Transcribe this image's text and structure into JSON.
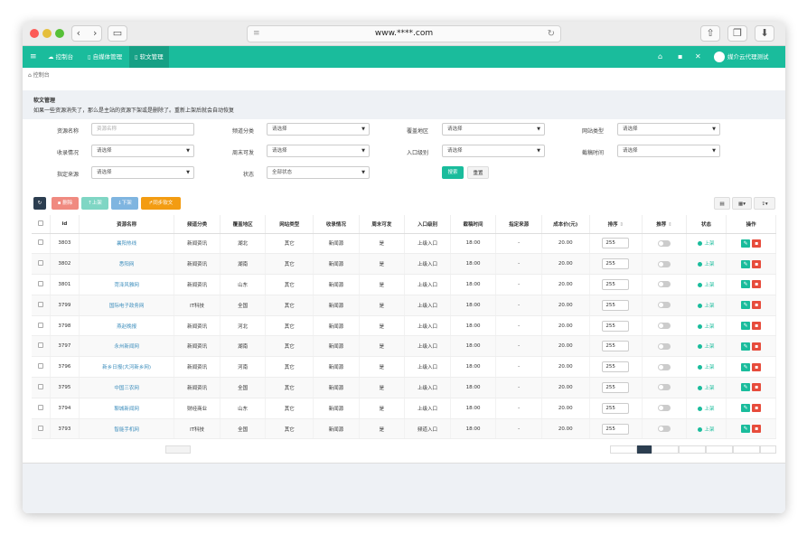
{
  "browser": {
    "url": "www.****.com"
  },
  "nav": {
    "items": [
      {
        "label": "控制台"
      },
      {
        "label": "自媒体管理"
      },
      {
        "label": "软文管理"
      }
    ],
    "user": "媒介云代理测试"
  },
  "breadcrumb": "控制台",
  "notice": {
    "title": "软文管理",
    "text": "如果一些资源消失了，那么是主站的资源下架或是删除了。重新上架后就会自动恢复"
  },
  "filters": {
    "resource_name": {
      "label": "资源名称",
      "placeholder": "资源名称"
    },
    "channel": {
      "label": "频道分类",
      "value": "请选择"
    },
    "region": {
      "label": "覆盖地区",
      "value": "请选择"
    },
    "site_type": {
      "label": "网站类型",
      "value": "请选择"
    },
    "index": {
      "label": "收录情况",
      "value": "请选择"
    },
    "weekend": {
      "label": "周末可发",
      "value": "请选择"
    },
    "entry": {
      "label": "入口级别",
      "value": "请选择"
    },
    "deadline": {
      "label": "截稿时间",
      "value": "请选择"
    },
    "source": {
      "label": "指定来源",
      "value": "请选择"
    },
    "status": {
      "label": "状态",
      "value": "全部状态"
    },
    "search_label": "搜索",
    "reset_label": "重置"
  },
  "toolbar": {
    "delete_label": "删除",
    "up_label": "上架",
    "down_label": "下架",
    "sync_label": "同步软文"
  },
  "table": {
    "headers": [
      "id",
      "资源名称",
      "频道分类",
      "覆盖地区",
      "网站类型",
      "收录情况",
      "周末可发",
      "入口级别",
      "截稿时间",
      "指定来源",
      "成本价(元)",
      "排序",
      "推荐",
      "状态",
      "操作"
    ],
    "rows": [
      {
        "id": "3803",
        "name": "襄阳热线",
        "channel": "新闻资讯",
        "region": "湖北",
        "type": "其它",
        "index": "新闻源",
        "weekend": "是",
        "entry": "上级入口",
        "deadline": "18:00",
        "source": "-",
        "price": "20.00",
        "sort": "255",
        "status": "上架"
      },
      {
        "id": "3802",
        "name": "悉阳网",
        "channel": "新闻资讯",
        "region": "湖南",
        "type": "其它",
        "index": "新闻源",
        "weekend": "是",
        "entry": "上级入口",
        "deadline": "18:00",
        "source": "-",
        "price": "20.00",
        "sort": "255",
        "status": "上架"
      },
      {
        "id": "3801",
        "name": "菏泽风雅网",
        "channel": "新闻资讯",
        "region": "山东",
        "type": "其它",
        "index": "新闻源",
        "weekend": "是",
        "entry": "上级入口",
        "deadline": "18:00",
        "source": "-",
        "price": "20.00",
        "sort": "255",
        "status": "上架"
      },
      {
        "id": "3799",
        "name": "国际电子政务网",
        "channel": "IT科技",
        "region": "全国",
        "type": "其它",
        "index": "新闻源",
        "weekend": "是",
        "entry": "上级入口",
        "deadline": "18:00",
        "source": "-",
        "price": "20.00",
        "sort": "255",
        "status": "上架"
      },
      {
        "id": "3798",
        "name": "燕赵晚报",
        "channel": "新闻资讯",
        "region": "河北",
        "type": "其它",
        "index": "新闻源",
        "weekend": "是",
        "entry": "上级入口",
        "deadline": "18:00",
        "source": "-",
        "price": "20.00",
        "sort": "255",
        "status": "上架"
      },
      {
        "id": "3797",
        "name": "永州新闻网",
        "channel": "新闻资讯",
        "region": "湖南",
        "type": "其它",
        "index": "新闻源",
        "weekend": "是",
        "entry": "上级入口",
        "deadline": "18:00",
        "source": "-",
        "price": "20.00",
        "sort": "255",
        "status": "上架"
      },
      {
        "id": "3796",
        "name": "新乡日报(大河新乡网)",
        "channel": "新闻资讯",
        "region": "河南",
        "type": "其它",
        "index": "新闻源",
        "weekend": "是",
        "entry": "上级入口",
        "deadline": "18:00",
        "source": "-",
        "price": "20.00",
        "sort": "255",
        "status": "上架"
      },
      {
        "id": "3795",
        "name": "中国三农网",
        "channel": "新闻资讯",
        "region": "全国",
        "type": "其它",
        "index": "新闻源",
        "weekend": "是",
        "entry": "上级入口",
        "deadline": "18:00",
        "source": "-",
        "price": "20.00",
        "sort": "255",
        "status": "上架"
      },
      {
        "id": "3794",
        "name": "聊城新闻网",
        "channel": "财经商业",
        "region": "山东",
        "type": "其它",
        "index": "新闻源",
        "weekend": "是",
        "entry": "上级入口",
        "deadline": "18:00",
        "source": "-",
        "price": "20.00",
        "sort": "255",
        "status": "上架"
      },
      {
        "id": "3793",
        "name": "智能手机网",
        "channel": "IT科技",
        "region": "全国",
        "type": "其它",
        "index": "新闻源",
        "weekend": "是",
        "entry": "频道入口",
        "deadline": "18:00",
        "source": "-",
        "price": "20.00",
        "sort": "255",
        "status": "上架"
      }
    ]
  },
  "colors": {
    "brand": "#1abc9c",
    "danger": "#e74c3c",
    "warning": "#f39c12"
  }
}
